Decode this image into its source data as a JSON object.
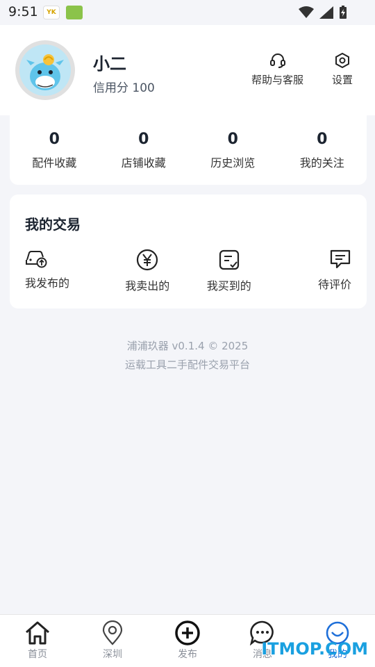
{
  "status_bar": {
    "time": "9:51",
    "app_icon_text": "YK"
  },
  "profile": {
    "username": "小二",
    "credit": "信用分 100",
    "help_label": "帮助与客服",
    "settings_label": "设置"
  },
  "stats": [
    {
      "value": "0",
      "label": "配件收藏"
    },
    {
      "value": "0",
      "label": "店铺收藏"
    },
    {
      "value": "0",
      "label": "历史浏览"
    },
    {
      "value": "0",
      "label": "我的关注"
    }
  ],
  "trades": {
    "title": "我的交易",
    "items": [
      {
        "label": "我发布的",
        "icon": "car-upload-icon"
      },
      {
        "label": "我卖出的",
        "icon": "yen-icon"
      },
      {
        "label": "我买到的",
        "icon": "order-check-icon"
      },
      {
        "label": "待评价",
        "icon": "comment-icon"
      }
    ]
  },
  "footer": {
    "version": "浦浦玖器 v0.1.4 © 2025",
    "tagline": "运载工具二手配件交易平台"
  },
  "nav": [
    {
      "label": "首页",
      "icon": "home-icon"
    },
    {
      "label": "深圳",
      "icon": "location-icon"
    },
    {
      "label": "发布",
      "icon": "add-icon"
    },
    {
      "label": "消息",
      "icon": "message-icon"
    },
    {
      "label": "我的",
      "icon": "profile-smile-icon",
      "active": true
    }
  ],
  "watermark": "ITMOP.COM",
  "colors": {
    "accent": "#1e6fd9",
    "background": "#f4f5f9"
  }
}
